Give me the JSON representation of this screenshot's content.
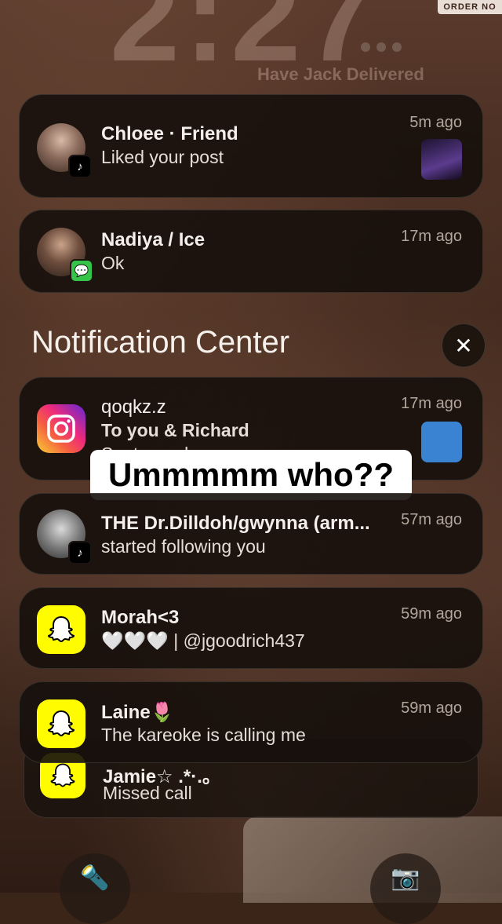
{
  "lock_screen": {
    "time": "2:27",
    "live_activity": "Have Jack Delivered",
    "corner_tag": "ORDER NO"
  },
  "notification_center": {
    "title": "Notification Center",
    "close_symbol": "✕"
  },
  "caption": "Ummmmm who??",
  "notifications": [
    {
      "app": "TikTok",
      "title": "Chloee · Friend",
      "body": "Liked your post",
      "time": "5m ago"
    },
    {
      "app": "Messages",
      "title": "Nadiya / Ice",
      "body": "Ok",
      "time": "17m ago"
    },
    {
      "app": "Instagram",
      "title": "qoqkz.z",
      "body": "To you & Richard",
      "body2": "Sent a reel",
      "time": "17m ago"
    },
    {
      "app": "TikTok",
      "title": "THE Dr.Dilldoh/gwynna (arm...",
      "body": "started following you",
      "time": "57m ago"
    },
    {
      "app": "Snapchat",
      "title": "Morah<3",
      "body": "🤍🤍🤍 | @jgoodrich437",
      "time": "59m ago"
    },
    {
      "app": "Snapchat",
      "title": "Laine🌷",
      "body": "The kareoke is calling me",
      "time": "59m ago"
    },
    {
      "app": "Snapchat",
      "title": "Jamie☆ .*·.。",
      "body": "Missed call",
      "time": ""
    }
  ],
  "icons": {
    "flashlight": "flashlight-icon",
    "camera": "camera-icon",
    "tiktok_glyph": "♪",
    "message_glyph": "💬",
    "flashlight_glyph": "🔦",
    "camera_glyph": "📷"
  }
}
